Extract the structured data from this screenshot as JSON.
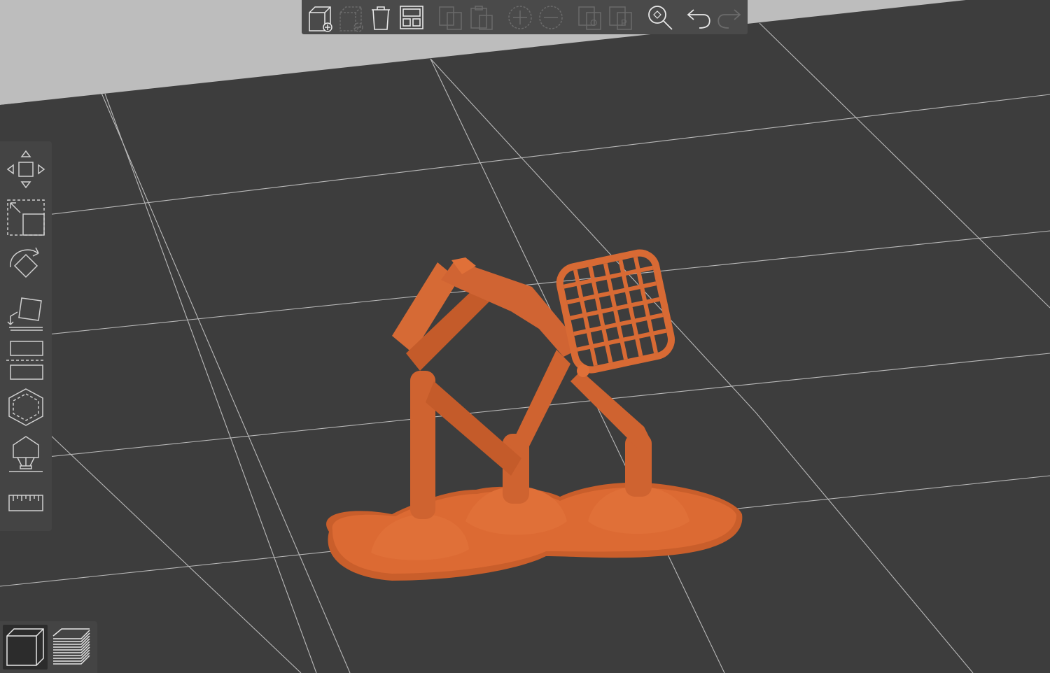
{
  "colors": {
    "bed": "#3d3d3d",
    "backdrop": "#bdbdbd",
    "grid_line": "#cfcfcf",
    "model": "#d86a34",
    "toolbar_bg": "#4a4a4a",
    "icon_active": "#e8e8e8",
    "icon_disabled": "#6b6b6b"
  },
  "top_toolbar": {
    "buttons": [
      {
        "icon": "add-object-icon",
        "enabled": true
      },
      {
        "icon": "remove-object-icon",
        "enabled": false
      },
      {
        "icon": "delete-all-icon",
        "enabled": true
      },
      {
        "icon": "arrange-icon",
        "enabled": true
      },
      {
        "icon": "copy-icon",
        "enabled": false
      },
      {
        "icon": "paste-icon",
        "enabled": false
      },
      {
        "icon": "add-instance-icon",
        "enabled": false
      },
      {
        "icon": "remove-instance-icon",
        "enabled": false
      },
      {
        "icon": "split-objects-icon",
        "enabled": false
      },
      {
        "icon": "split-parts-icon",
        "enabled": false
      },
      {
        "icon": "search-icon",
        "enabled": true
      },
      {
        "icon": "undo-icon",
        "enabled": true
      },
      {
        "icon": "redo-icon",
        "enabled": false
      }
    ]
  },
  "left_toolbar": {
    "tools": [
      "move-icon",
      "scale-icon",
      "rotate-icon",
      "place-on-face-icon",
      "cut-icon",
      "hollow-icon",
      "support-points-icon",
      "measure-icon"
    ]
  },
  "view_toggle": {
    "buttons": [
      {
        "icon": "3d-view-icon",
        "selected": true
      },
      {
        "icon": "preview-layers-icon",
        "selected": false
      }
    ]
  }
}
